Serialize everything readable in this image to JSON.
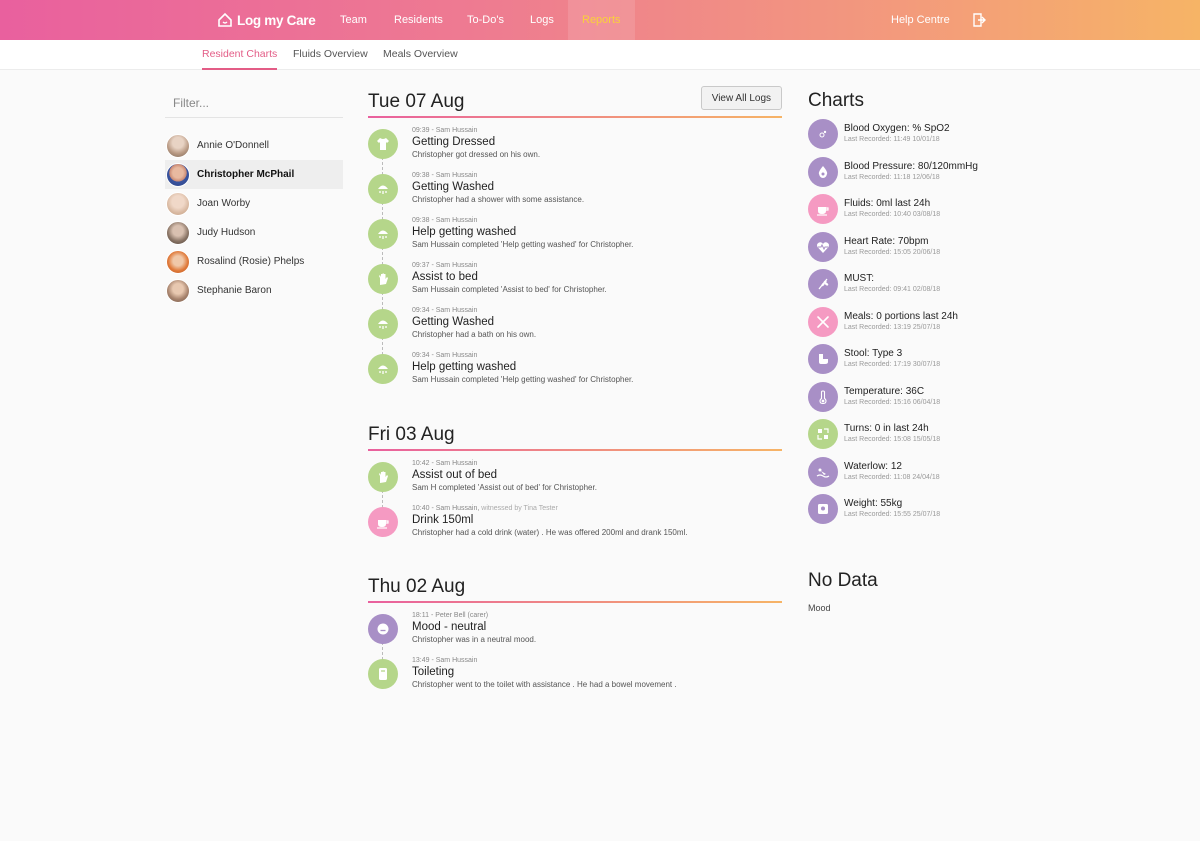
{
  "app": {
    "logo": "Log my Care",
    "nav": [
      "Team",
      "Residents",
      "To-Do's",
      "Logs",
      "Reports"
    ],
    "help": "Help Centre"
  },
  "subnav": [
    "Resident Charts",
    "Fluids Overview",
    "Meals Overview"
  ],
  "filter": {
    "placeholder": "Filter..."
  },
  "residents": [
    {
      "name": "Annie O'Donnell",
      "color": "#b99a84"
    },
    {
      "name": "Christopher McPhail",
      "color": "#6a7fb0"
    },
    {
      "name": "Joan Worby",
      "color": "#d8b8a0"
    },
    {
      "name": "Judy Hudson",
      "color": "#8a7566"
    },
    {
      "name": "Rosalind (Rosie) Phelps",
      "color": "#e07a3a"
    },
    {
      "name": "Stephanie Baron",
      "color": "#a8846e"
    }
  ],
  "timeline": {
    "view_all": "View All Logs",
    "days": [
      {
        "title": "Tue 07 Aug",
        "events": [
          {
            "meta": "09:39 - Sam Hussain",
            "title": "Getting Dressed",
            "desc": "Christopher got dressed on his own.",
            "color": "green",
            "icon": "shirt-icon"
          },
          {
            "meta": "09:38 - Sam Hussain",
            "title": "Getting Washed",
            "desc": "Christopher had a shower with some assistance.",
            "color": "green",
            "icon": "shower-icon"
          },
          {
            "meta": "09:38 - Sam Hussain",
            "title": "Help getting washed",
            "desc": "Sam Hussain completed 'Help getting washed' for Christopher.",
            "color": "green",
            "icon": "shower-icon"
          },
          {
            "meta": "09:37 - Sam Hussain",
            "title": "Assist to bed",
            "desc": "Sam Hussain completed 'Assist to bed' for Christopher.",
            "color": "green",
            "icon": "hand-icon"
          },
          {
            "meta": "09:34 - Sam Hussain",
            "title": "Getting Washed",
            "desc": "Christopher had a bath on his own.",
            "color": "green",
            "icon": "shower-icon"
          },
          {
            "meta": "09:34 - Sam Hussain",
            "title": "Help getting washed",
            "desc": "Sam Hussain completed 'Help getting washed' for Christopher.",
            "color": "green",
            "icon": "shower-icon"
          }
        ]
      },
      {
        "title": "Fri 03 Aug",
        "events": [
          {
            "meta": "10:42 - Sam Hussain",
            "title": "Assist out of bed",
            "desc": "Sam H completed 'Assist out of bed' for Christopher.",
            "color": "green",
            "icon": "hand-icon"
          },
          {
            "meta": "10:40 - Sam Hussain,",
            "witness": " witnessed by Tina Tester",
            "title": "Drink 150ml",
            "desc": "Christopher had a cold drink (water) . He was offered 200ml and drank 150ml.",
            "color": "pink",
            "icon": "cup-icon"
          }
        ]
      },
      {
        "title": "Thu 02 Aug",
        "events": [
          {
            "meta": "18:11 - Peter Bell (carer)",
            "title": "Mood - neutral",
            "desc": "Christopher was in a neutral mood.",
            "color": "purple",
            "icon": "face-icon"
          },
          {
            "meta": "13:49 - Sam Hussain",
            "title": "Toileting",
            "desc": "Christopher went to the toilet with assistance . He had a bowel movement .",
            "color": "green",
            "icon": "toilet-icon"
          }
        ]
      }
    ]
  },
  "charts": {
    "title": "Charts",
    "items": [
      {
        "label": "Blood Oxygen: % SpO2",
        "sub": "Last Recorded: 11:49 10/01/18",
        "color": "purple",
        "icon": "oxygen-icon"
      },
      {
        "label": "Blood Pressure: 80/120mmHg",
        "sub": "Last Recorded: 11:18 12/06/18",
        "color": "purple",
        "icon": "blood-drop-icon"
      },
      {
        "label": "Fluids: 0ml last 24h",
        "sub": "Last Recorded: 10:40 03/08/18",
        "color": "pink",
        "icon": "cup-icon"
      },
      {
        "label": "Heart Rate: 70bpm",
        "sub": "Last Recorded: 15:05 20/06/18",
        "color": "purple",
        "icon": "heart-icon"
      },
      {
        "label": "MUST:",
        "sub": "Last Recorded: 09:41 02/08/18",
        "color": "purple",
        "icon": "wheat-icon"
      },
      {
        "label": "Meals: 0 portions last 24h",
        "sub": "Last Recorded: 13:19 25/07/18",
        "color": "pink",
        "icon": "cutlery-icon"
      },
      {
        "label": "Stool: Type 3",
        "sub": "Last Recorded: 17:19 30/07/18",
        "color": "purple",
        "icon": "stool-icon"
      },
      {
        "label": "Temperature: 36C",
        "sub": "Last Recorded: 15:16 06/04/18",
        "color": "purple",
        "icon": "thermometer-icon"
      },
      {
        "label": "Turns: 0 in last 24h",
        "sub": "Last Recorded: 15:08 15/05/18",
        "color": "green",
        "icon": "turn-icon"
      },
      {
        "label": "Waterlow: 12",
        "sub": "Last Recorded: 11:08 24/04/18",
        "color": "purple",
        "icon": "waterlow-icon"
      },
      {
        "label": "Weight: 55kg",
        "sub": "Last Recorded: 15:55 25/07/18",
        "color": "purple",
        "icon": "scale-icon"
      }
    ]
  },
  "nodata": {
    "title": "No Data",
    "items": [
      "Mood"
    ]
  }
}
